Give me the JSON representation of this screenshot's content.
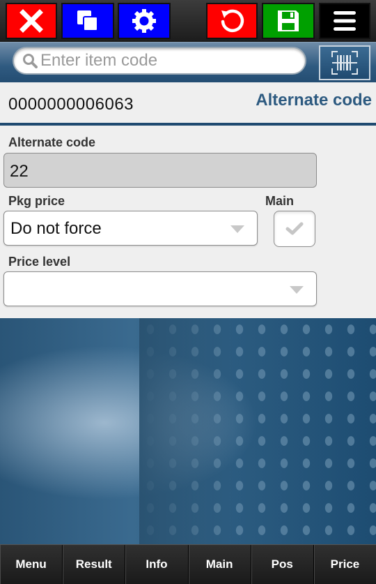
{
  "toolbar": {
    "buttons": [
      {
        "name": "close",
        "icon": "close-icon",
        "color": "#ff0000"
      },
      {
        "name": "copy",
        "icon": "copy-icon",
        "color": "#0000ff"
      },
      {
        "name": "settings",
        "icon": "gear-icon",
        "color": "#0000ff"
      },
      {
        "name": "undo",
        "icon": "undo-icon",
        "color": "#ff0000"
      },
      {
        "name": "save",
        "icon": "save-icon",
        "color": "#00a000"
      },
      {
        "name": "menu",
        "icon": "hamburger-icon",
        "color": "#000000"
      }
    ]
  },
  "search": {
    "placeholder": "Enter item code",
    "value": "",
    "scan_icon": "barcode-scan-icon"
  },
  "header": {
    "item_code": "0000000006063",
    "title": "Alternate code"
  },
  "form": {
    "alternate_code": {
      "label": "Alternate code",
      "value": "22"
    },
    "pkg_price": {
      "label": "Pkg price",
      "value": "Do not force"
    },
    "main": {
      "label": "Main",
      "checked": true
    },
    "price_level": {
      "label": "Price level",
      "value": ""
    }
  },
  "bottom_nav": {
    "items": [
      "Menu",
      "Result",
      "Info",
      "Main",
      "Pos",
      "Price"
    ]
  },
  "colors": {
    "accent": "#2d5a80",
    "toolbar_red": "#ff0000",
    "toolbar_blue": "#0000ff",
    "toolbar_green": "#00a000"
  }
}
